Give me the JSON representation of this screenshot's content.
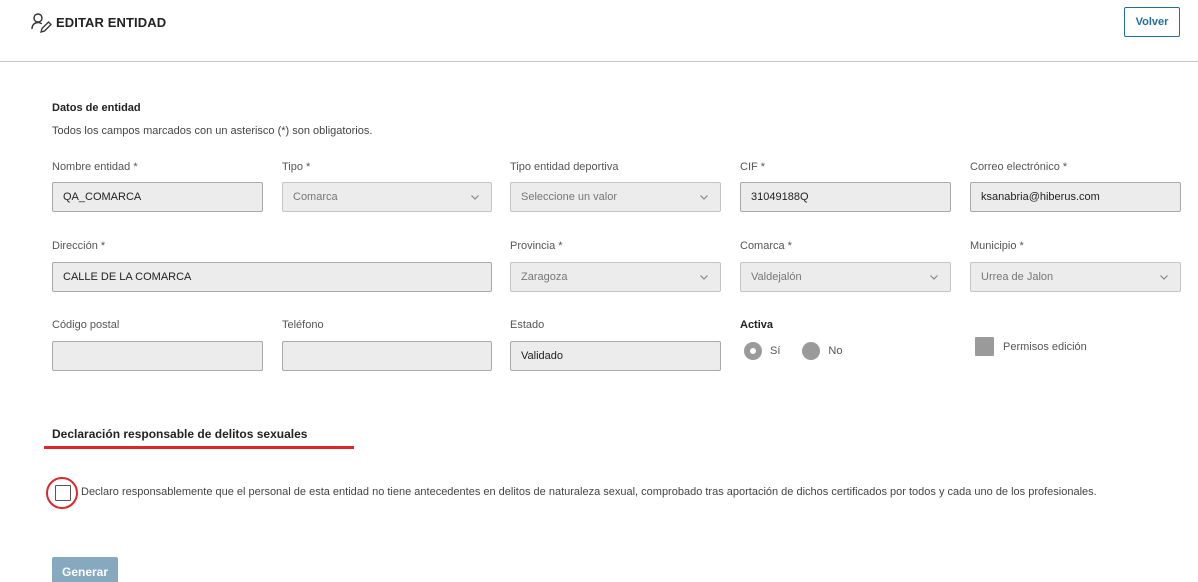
{
  "header": {
    "title": "EDITAR ENTIDAD",
    "title_icon": "users-edit-icon",
    "back_label": "Volver"
  },
  "section": {
    "title": "Datos de entidad",
    "note": "Todos los campos marcados con un asterisco (*) son obligatorios."
  },
  "form": {
    "nombre": {
      "label": "Nombre entidad *",
      "value": "QA_COMARCA"
    },
    "tipo": {
      "label": "Tipo *",
      "value": "Comarca"
    },
    "tipo_deportiva": {
      "label": "Tipo entidad deportiva",
      "value": "Seleccione un valor"
    },
    "cif": {
      "label": "CIF *",
      "value": "31049188Q"
    },
    "correo": {
      "label": "Correo electrónico *",
      "value": "ksanabria@hiberus.com"
    },
    "direccion": {
      "label": "Dirección *",
      "value": "CALLE DE LA COMARCA"
    },
    "provincia": {
      "label": "Provincia *",
      "value": "Zaragoza"
    },
    "comarca": {
      "label": "Comarca *",
      "value": "Valdejalón"
    },
    "municipio": {
      "label": "Municipio *",
      "value": "Urrea de Jalon"
    },
    "codigo_postal": {
      "label": "Código postal",
      "value": ""
    },
    "telefono": {
      "label": "Teléfono",
      "value": ""
    },
    "estado": {
      "label": "Estado",
      "value": "Validado"
    },
    "activa": {
      "label": "Activa",
      "si_label": "Sí",
      "no_label": "No",
      "selected": "Sí"
    },
    "permisos": {
      "label": "Permisos edición",
      "checked": false
    }
  },
  "declaration": {
    "title": "Declaración responsable de delitos sexuales",
    "text": "Declaro responsablemente que el personal de esta entidad no tiene antecedentes en delitos de naturaleza sexual, comprobado tras aportación de dichos certificados por todos y cada uno de los profesionales.",
    "checked": false,
    "accent_color": "#e0262d"
  },
  "actions": {
    "generate_label": "Generar"
  },
  "colors": {
    "primary": "#1f6e9e",
    "disabled_button": "#86a9bf",
    "field_bg": "#ececec",
    "highlight": "#e0262d"
  }
}
